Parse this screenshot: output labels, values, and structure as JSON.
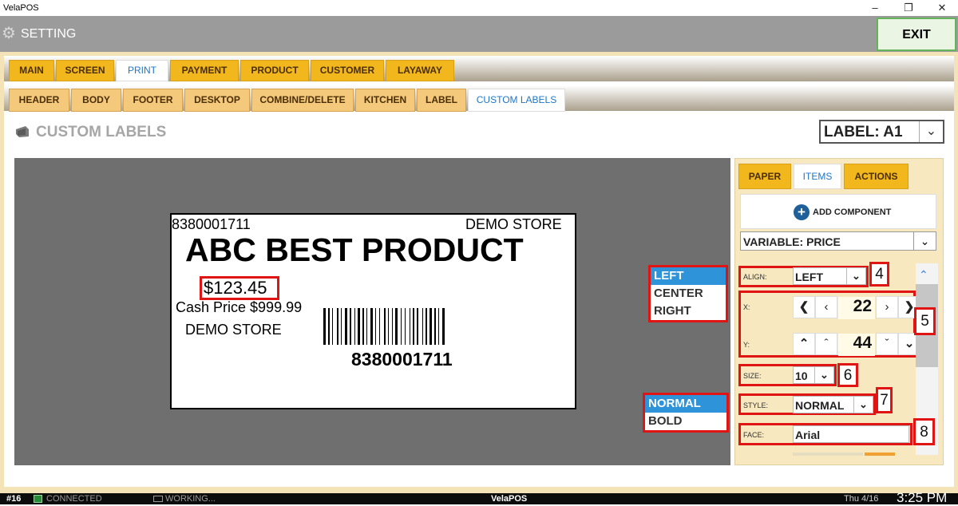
{
  "window": {
    "title": "VelaPOS"
  },
  "header": {
    "title": "SETTING",
    "exit_label": "EXIT"
  },
  "main_tabs": [
    "MAIN",
    "SCREEN",
    "PRINT",
    "PAYMENT",
    "PRODUCT",
    "CUSTOMER",
    "LAYAWAY"
  ],
  "main_tab_active": "PRINT",
  "sub_tabs": [
    "HEADER",
    "BODY",
    "FOOTER",
    "DESKTOP",
    "COMBINE/DELETE",
    "KITCHEN",
    "LABEL",
    "CUSTOM LABELS"
  ],
  "sub_tab_active": "CUSTOM LABELS",
  "section_title": "CUSTOM LABELS",
  "label_select": "LABEL: A1",
  "label_preview": {
    "top_left": "8380001711",
    "top_right": "DEMO STORE",
    "product_name": "ABC BEST PRODUCT",
    "price": "$123.45",
    "cash_price": "Cash Price $999.99",
    "store": "DEMO STORE",
    "barcode_text": "8380001711"
  },
  "align_options": [
    "LEFT",
    "CENTER",
    "RIGHT"
  ],
  "align_selected": "LEFT",
  "style_options": [
    "NORMAL",
    "BOLD"
  ],
  "style_selected": "NORMAL",
  "panel": {
    "tabs": [
      "PAPER",
      "ITEMS",
      "ACTIONS"
    ],
    "active_tab": "ITEMS",
    "add_component": "ADD COMPONENT",
    "variable": "VARIABLE: PRICE",
    "align_label": "ALIGN:",
    "align_value": "LEFT",
    "x_label": "X:",
    "x_value": "22",
    "y_label": "Y:",
    "y_value": "44",
    "size_label": "SIZE:",
    "size_value": "10",
    "style_label": "STYLE:",
    "style_value": "NORMAL",
    "face_label": "FACE:",
    "face_value": "Arial"
  },
  "callouts": [
    "4",
    "5",
    "6",
    "7",
    "8"
  ],
  "taskbar": {
    "terminal": "#16",
    "connection": "CONNECTED",
    "status": "WORKING...",
    "app": "VelaPOS",
    "date": "Thu 4/16",
    "time": "3:25 PM"
  },
  "colors": {
    "accent_tab": "#f2b71d",
    "sub_tab": "#f5c97b",
    "highlight": "#e11414",
    "selected": "#2e93d8",
    "exit_border": "#63b45a"
  }
}
